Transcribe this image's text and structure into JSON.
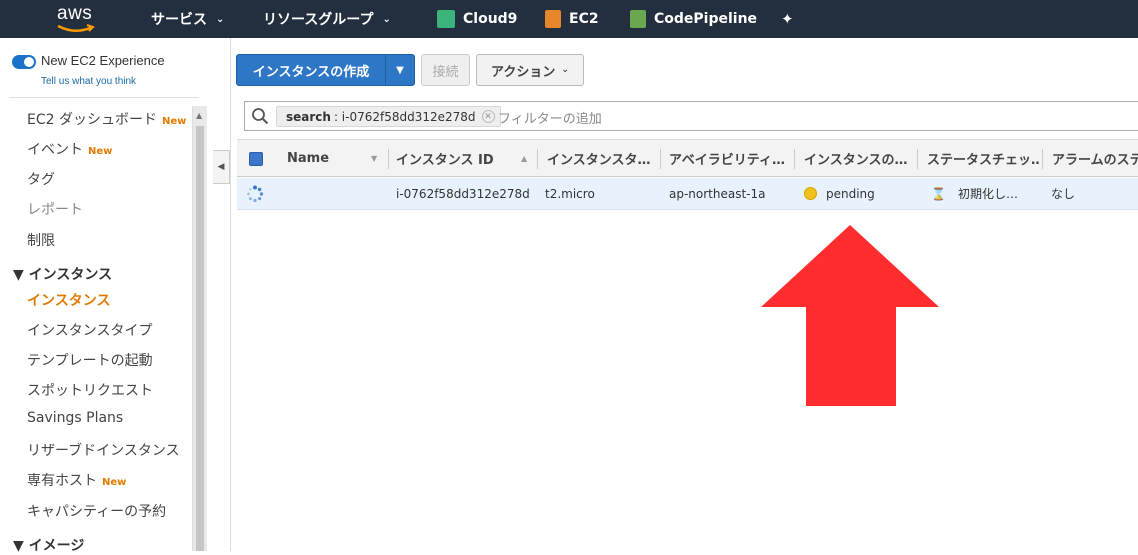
{
  "topnav": {
    "logo": "aws",
    "services_label": "サービス",
    "resource_groups_label": "リソースグループ",
    "favorites": [
      {
        "label": "Cloud9",
        "icon": "cloud9-icon",
        "color": "#3bb37a"
      },
      {
        "label": "EC2",
        "icon": "ec2-icon",
        "color": "#e8862b"
      },
      {
        "label": "CodePipeline",
        "icon": "codepipeline-icon",
        "color": "#6aa84f"
      }
    ],
    "pin_icon": "pin-icon"
  },
  "sidebar": {
    "toggle_label": "New EC2 Experience",
    "tell_link": "Tell us what you think",
    "items": [
      {
        "label": "EC2 ダッシュボード",
        "new": "New"
      },
      {
        "label": "イベント",
        "new": "New"
      },
      {
        "label": "タグ"
      },
      {
        "label": "レポート"
      },
      {
        "label": "制限"
      }
    ],
    "section_instances": "▼ インスタンス",
    "instance_items": [
      {
        "label": "インスタンス"
      },
      {
        "label": "インスタンスタイプ"
      },
      {
        "label": "テンプレートの起動"
      },
      {
        "label": "スポットリクエスト"
      },
      {
        "label": "Savings Plans"
      },
      {
        "label": "リザーブドインスタンス"
      },
      {
        "label": "専有ホスト",
        "new": "New"
      },
      {
        "label": "キャパシティーの予約"
      }
    ],
    "section_images": "▼ イメージ"
  },
  "toolbar": {
    "create_label": "インスタンスの作成",
    "connect_label": "接続",
    "action_label": "アクション"
  },
  "filter": {
    "chip_key": "search",
    "chip_value": ": i-0762f58dd312e278d",
    "placeholder": "フィルターの追加"
  },
  "table": {
    "columns": [
      "Name",
      "インスタンス ID",
      "インスタンスタ…",
      "アベイラビリティ…",
      "インスタンスの…",
      "ステータスチェッ…",
      "アラームのステ"
    ],
    "row": {
      "name": "",
      "instance_id": "i-0762f58dd312e278d",
      "instance_type": "t2.micro",
      "az": "ap-northeast-1a",
      "state": "pending",
      "status_check": "初期化し…",
      "alarm": "なし"
    }
  },
  "colors": {
    "nav_bg": "#232f3e",
    "primary": "#2e77c6",
    "accent_new": "#e07b00",
    "pending": "#f3c11d",
    "arrow": "#ff2d2d"
  }
}
